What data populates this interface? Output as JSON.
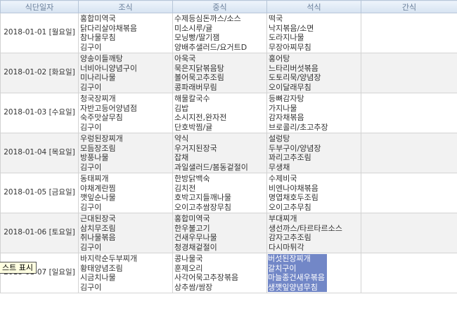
{
  "headers": [
    "식단일자",
    "조식",
    "중식",
    "석식",
    "간식"
  ],
  "rows": [
    {
      "date": "2018-01-01 [월요일]",
      "breakfast": [
        "홍합미역국",
        "닭다리살야채볶음",
        "참나물무침",
        "김구이"
      ],
      "lunch": [
        "수제등심돈까스/소스",
        "미소시루/귤",
        "모닝빵/딸기잼",
        "양배추샐러드/요거트D"
      ],
      "dinner": [
        "떡국",
        "낙지볶음/소면",
        "도라지나물",
        "무장아찌무침"
      ],
      "snack": []
    },
    {
      "date": "2018-01-02 [화요일]",
      "breakfast": [
        "양송이들깨탕",
        "너비아니양념구이",
        "미나리나물",
        "김구이"
      ],
      "lunch": [
        "아욱국",
        "묵은지닭볶음탕",
        "볼어묵고추조림",
        "콩파래버무림"
      ],
      "dinner": [
        "홍어탕",
        "느타리버섯볶음",
        "도토리묵/양념장",
        "오이달래무침"
      ],
      "snack": []
    },
    {
      "date": "2018-01-03 [수요일]",
      "breakfast": [
        "청국장찌개",
        "자반고등어양념점",
        "숙주맛살무침",
        "김구이"
      ],
      "lunch": [
        "해물칼국수",
        "김밥",
        "소시지전,완자전",
        "단호박찜/귤"
      ],
      "dinner": [
        "등뼈감자탕",
        "가지나물",
        "감자채볶음",
        "브로콜리/초고추장"
      ],
      "snack": []
    },
    {
      "date": "2018-01-04 [목요일]",
      "breakfast": [
        "우렁된장찌개",
        "모듬장조림",
        "방풍나물",
        "김구이"
      ],
      "lunch": [
        "약식",
        "우거지된장국",
        "잡채",
        "과일샐러드/봄동겉절이"
      ],
      "dinner": [
        "설렁탕",
        "두부구이/양념장",
        "꽈리고추조림",
        "무생채"
      ],
      "snack": []
    },
    {
      "date": "2018-01-05 [금요일]",
      "breakfast": [
        "동태찌개",
        "야채계란찜",
        "깻잎순나물",
        "김구이"
      ],
      "lunch": [
        "한방닭백숙",
        "김치전",
        "호박고지들깨나물",
        "오이고추쌈장무침"
      ],
      "dinner": [
        "수제비국",
        "비엔나야채볶음",
        "명엽채호두조림",
        "오이고추무침"
      ],
      "snack": []
    },
    {
      "date": "2018-01-06 [토요일]",
      "breakfast": [
        "근대된장국",
        "삼치무조림",
        "취나물볶음",
        "김구이"
      ],
      "lunch": [
        "홍합미역국",
        "한우불고기",
        "건새우무나물",
        "청경채겉절이"
      ],
      "dinner": [
        "부대찌개",
        "생선까스/타르타르소스",
        "감자고추조림",
        "다시마튀각"
      ],
      "snack": []
    },
    {
      "date": "2018-01-07 [일요일]",
      "breakfast": [
        "바지락순두부찌개",
        "황태양념조림",
        "시금치나물",
        "김구이"
      ],
      "lunch": [
        "콩나물국",
        "훈제오리",
        "사각어묵고추장볶음",
        "상추쌈/쌈장"
      ],
      "dinner": [
        "버섯된장찌개",
        "갈치구이",
        "마늘종건새우볶음",
        "생깻잎양념무침"
      ],
      "snack": []
    }
  ],
  "tooltip": "스트 표시",
  "colors": {
    "header_text": "#6a7f9a",
    "selection": "#7287c7",
    "tooltip_bg": "#ffffe1"
  }
}
